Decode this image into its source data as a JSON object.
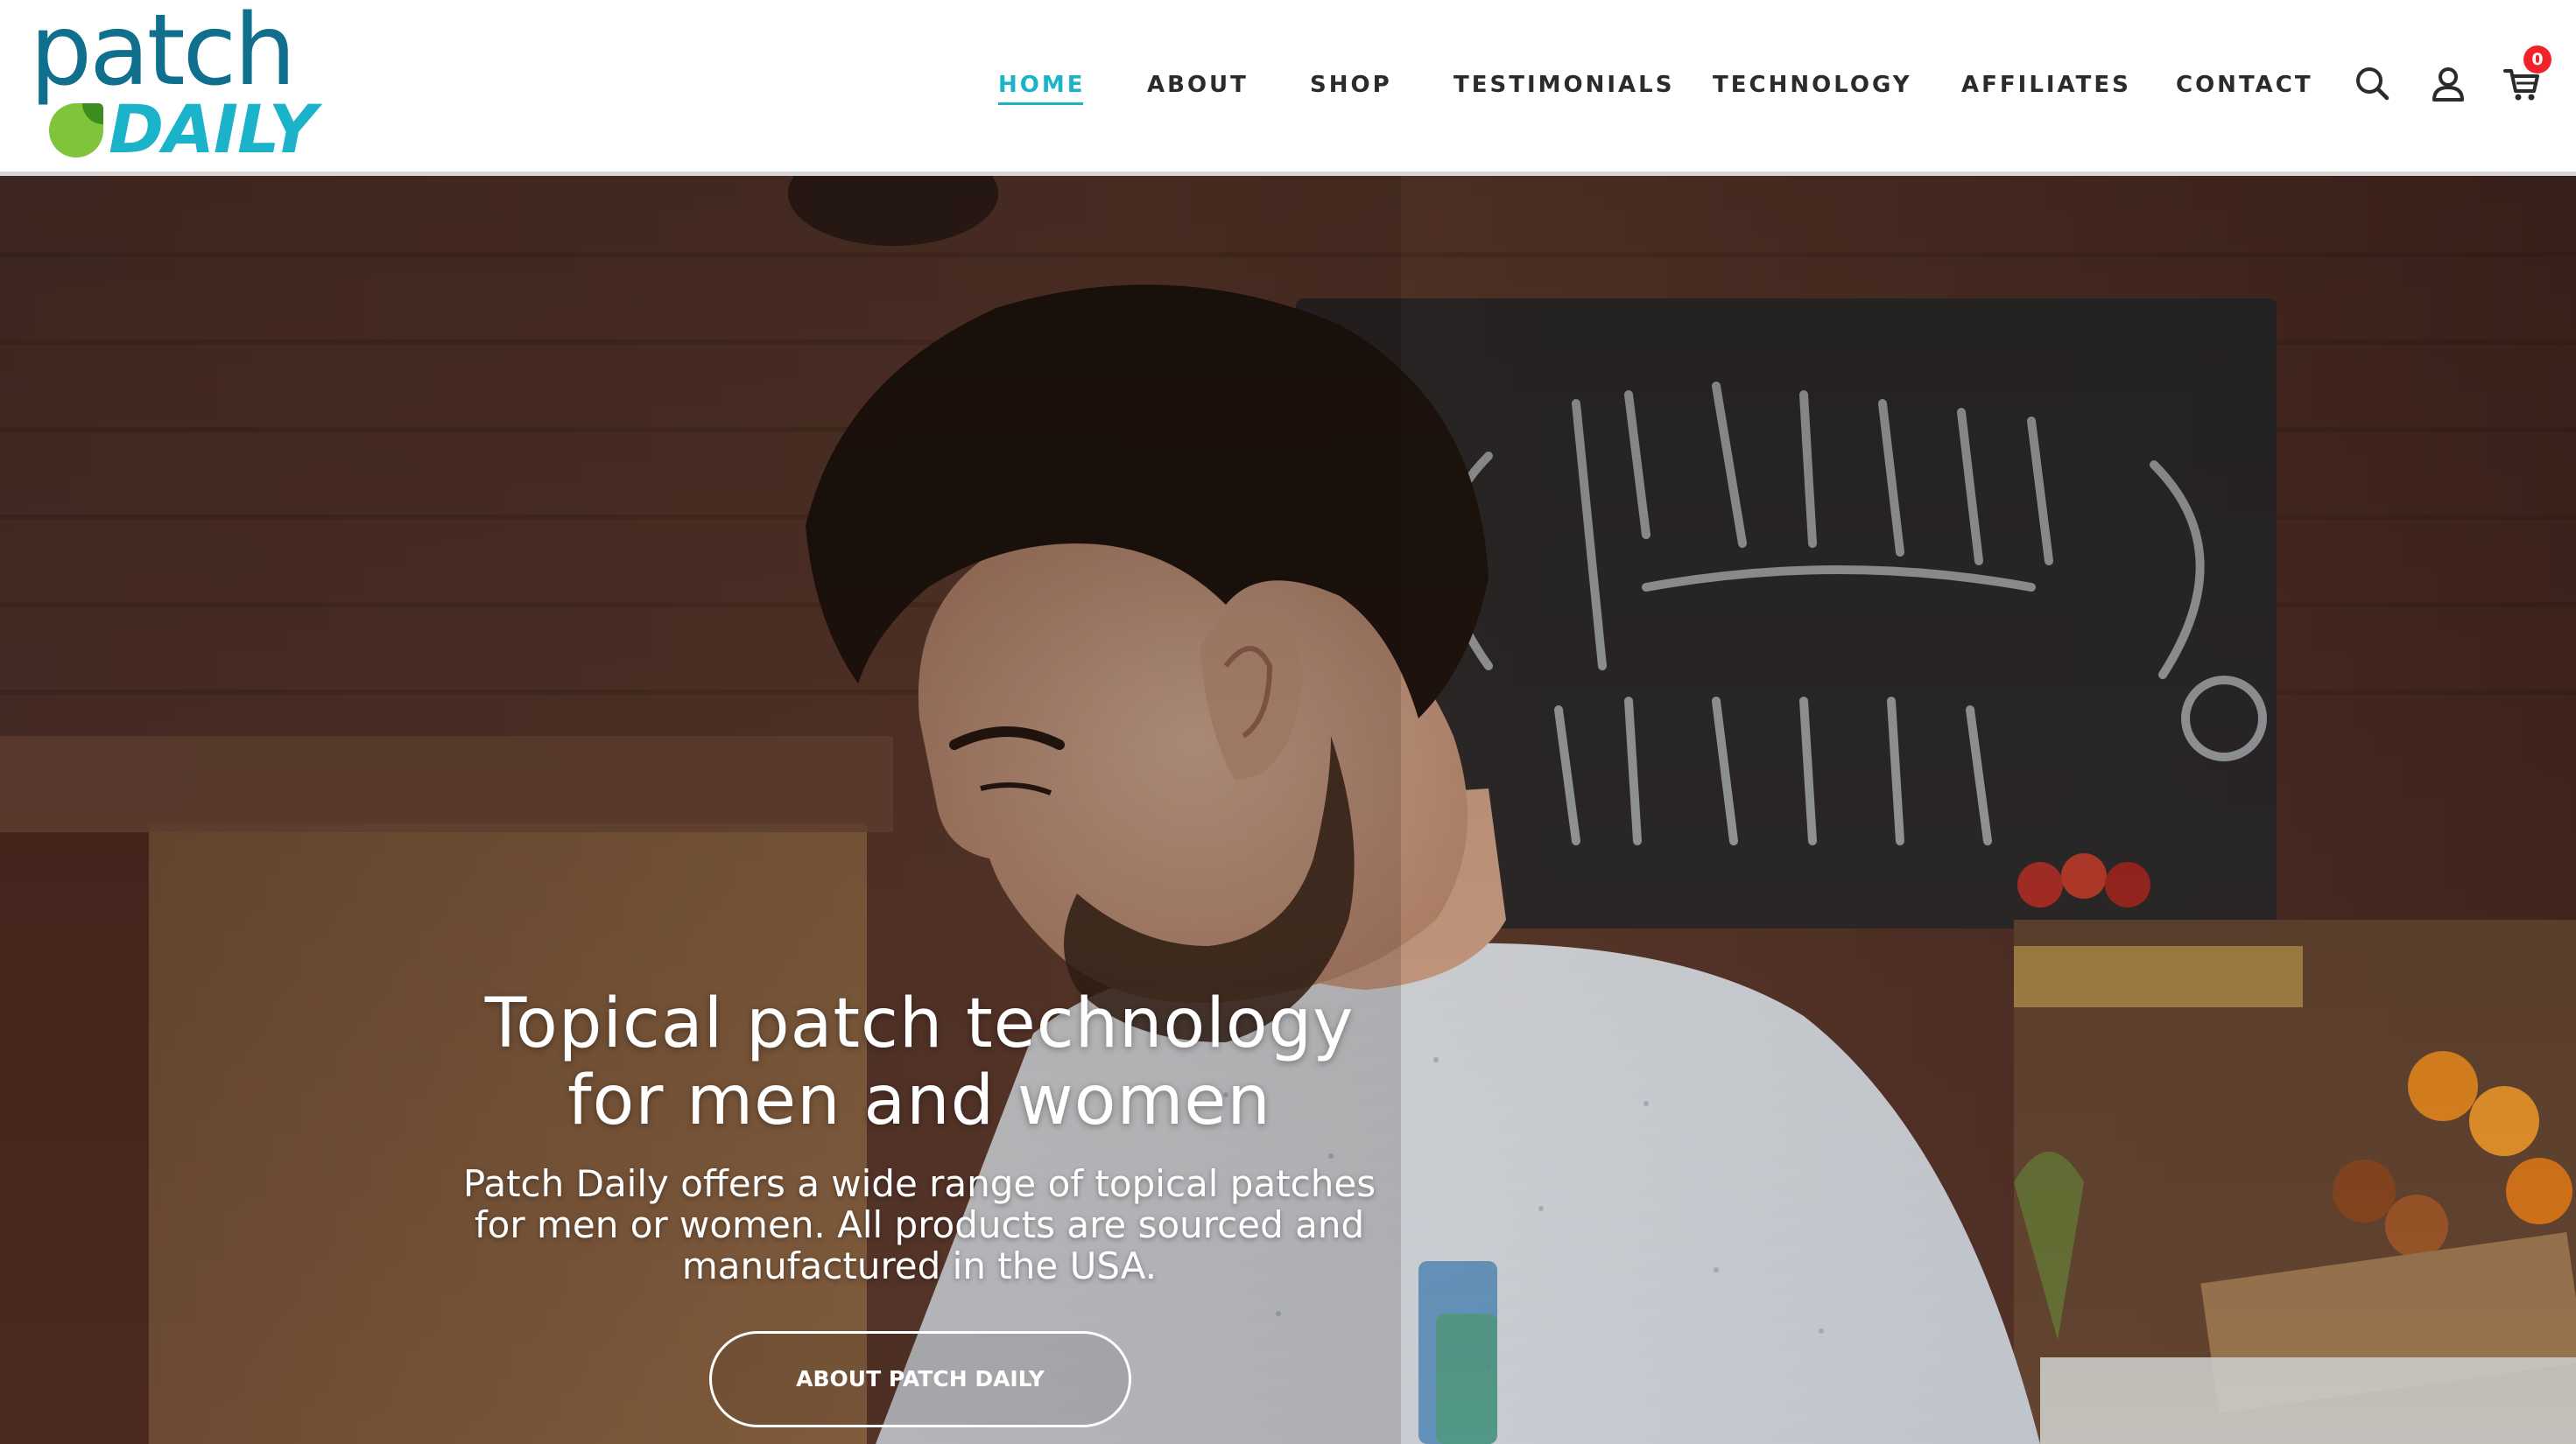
{
  "brand": {
    "logo_top": "patch",
    "logo_bottom": "DAILY",
    "colors": {
      "primary_teal": "#0f6f8c",
      "accent_cyan": "#1ab3c9",
      "leaf_green": "#7fc43a",
      "badge_red": "#f2222b"
    }
  },
  "nav": {
    "items": [
      {
        "label": "HOME",
        "active": true
      },
      {
        "label": "ABOUT",
        "active": false
      },
      {
        "label": "SHOP",
        "active": false
      },
      {
        "label": "TESTIMONIALS",
        "active": false
      },
      {
        "label": "TECHNOLOGY",
        "active": false
      },
      {
        "label": "AFFILIATES",
        "active": false
      },
      {
        "label": "CONTACT",
        "active": false
      }
    ],
    "icons": [
      "search-icon",
      "account-icon",
      "cart-icon"
    ],
    "cart_count": "0"
  },
  "hero": {
    "title_lines": [
      "Topical patch technology",
      "for men and women"
    ],
    "subtitle_lines": [
      "Patch Daily offers a wide range of topical patches",
      "for men or women. All products are sourced and",
      "manufactured in the USA."
    ],
    "button_label": "ABOUT PATCH DAILY",
    "background_description_colors": {
      "brick": "#5a3528",
      "shirt": "#e9ecef"
    }
  }
}
